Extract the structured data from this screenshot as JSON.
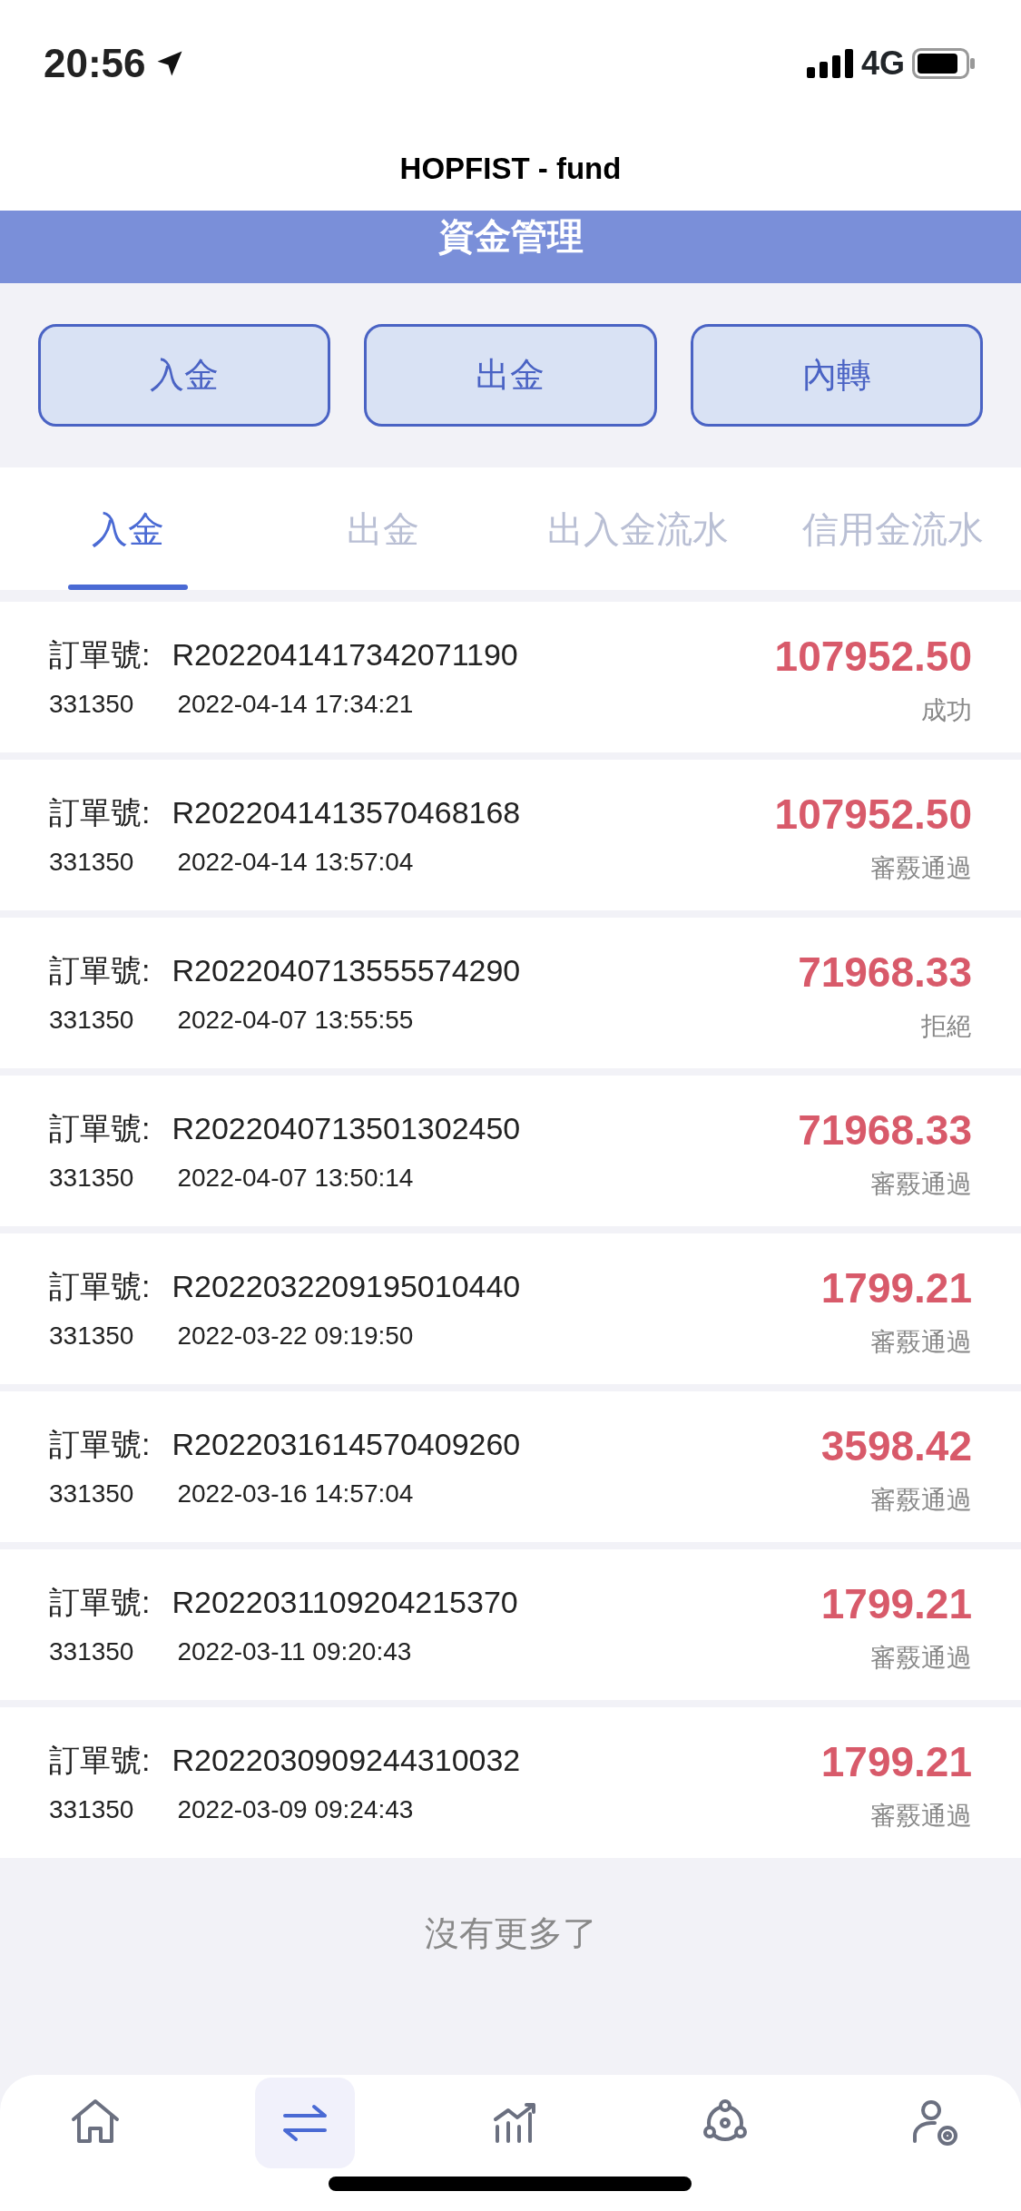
{
  "status_bar": {
    "time": "20:56",
    "network": "4G"
  },
  "header": {
    "title": "HOPFIST - fund",
    "subtitle": "資金管理"
  },
  "actions": [
    "入金",
    "出金",
    "內轉"
  ],
  "tabs": [
    {
      "label": "入金",
      "selected": true
    },
    {
      "label": "出金",
      "selected": false
    },
    {
      "label": "出入金流水",
      "selected": false
    },
    {
      "label": "信用金流水",
      "selected": false
    }
  ],
  "records": [
    {
      "order_label": "訂單號:",
      "order_no": "R2022041417342071190",
      "account": "331350",
      "time": "2022-04-14 17:34:21",
      "amount": "107952.50",
      "status": "成功"
    },
    {
      "order_label": "訂單號:",
      "order_no": "R2022041413570468168",
      "account": "331350",
      "time": "2022-04-14 13:57:04",
      "amount": "107952.50",
      "status": "審覈通過"
    },
    {
      "order_label": "訂單號:",
      "order_no": "R2022040713555574290",
      "account": "331350",
      "time": "2022-04-07 13:55:55",
      "amount": "71968.33",
      "status": "拒絕"
    },
    {
      "order_label": "訂單號:",
      "order_no": "R2022040713501302450",
      "account": "331350",
      "time": "2022-04-07 13:50:14",
      "amount": "71968.33",
      "status": "審覈通過"
    },
    {
      "order_label": "訂單號:",
      "order_no": "R2022032209195010440",
      "account": "331350",
      "time": "2022-03-22 09:19:50",
      "amount": "1799.21",
      "status": "審覈通過"
    },
    {
      "order_label": "訂單號:",
      "order_no": "R2022031614570409260",
      "account": "331350",
      "time": "2022-03-16 14:57:04",
      "amount": "3598.42",
      "status": "審覈通過"
    },
    {
      "order_label": "訂單號:",
      "order_no": "R2022031109204215370",
      "account": "331350",
      "time": "2022-03-11 09:20:43",
      "amount": "1799.21",
      "status": "審覈通過"
    },
    {
      "order_label": "訂單號:",
      "order_no": "R2022030909244310032",
      "account": "331350",
      "time": "2022-03-09 09:24:43",
      "amount": "1799.21",
      "status": "審覈通過"
    }
  ],
  "end_text": "沒有更多了",
  "nav": [
    {
      "kind": "home",
      "selected": false
    },
    {
      "kind": "transfer",
      "selected": true
    },
    {
      "kind": "chart",
      "selected": false
    },
    {
      "kind": "network",
      "selected": false
    },
    {
      "kind": "user",
      "selected": false
    }
  ]
}
